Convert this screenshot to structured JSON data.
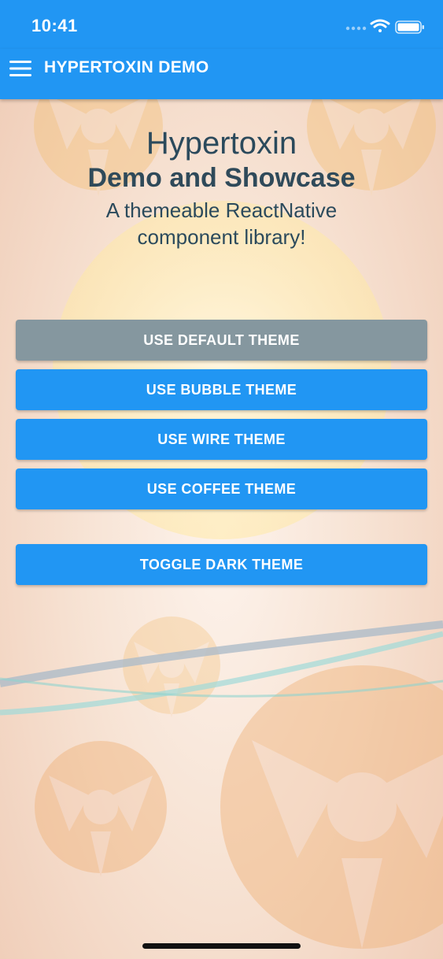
{
  "status_bar": {
    "time": "10:41",
    "icons": [
      "signal-dots-icon",
      "wifi-icon",
      "battery-icon"
    ]
  },
  "app_bar": {
    "menu_icon": "hamburger-menu-icon",
    "title": "HYPERTOXIN DEMO"
  },
  "hero": {
    "title": "Hypertoxin",
    "subtitle": "Demo and Showcase",
    "tagline_line1": "A themeable ReactNative",
    "tagline_line2": "component library!"
  },
  "buttons": {
    "default_theme": "USE DEFAULT THEME",
    "bubble_theme": "USE BUBBLE THEME",
    "wire_theme": "USE WIRE THEME",
    "coffee_theme": "USE COFFEE THEME",
    "toggle_dark": "TOGGLE DARK THEME"
  },
  "colors": {
    "primary": "#2196f3",
    "default_theme_button": "#85979f",
    "heading_text": "#2b4a5c"
  }
}
